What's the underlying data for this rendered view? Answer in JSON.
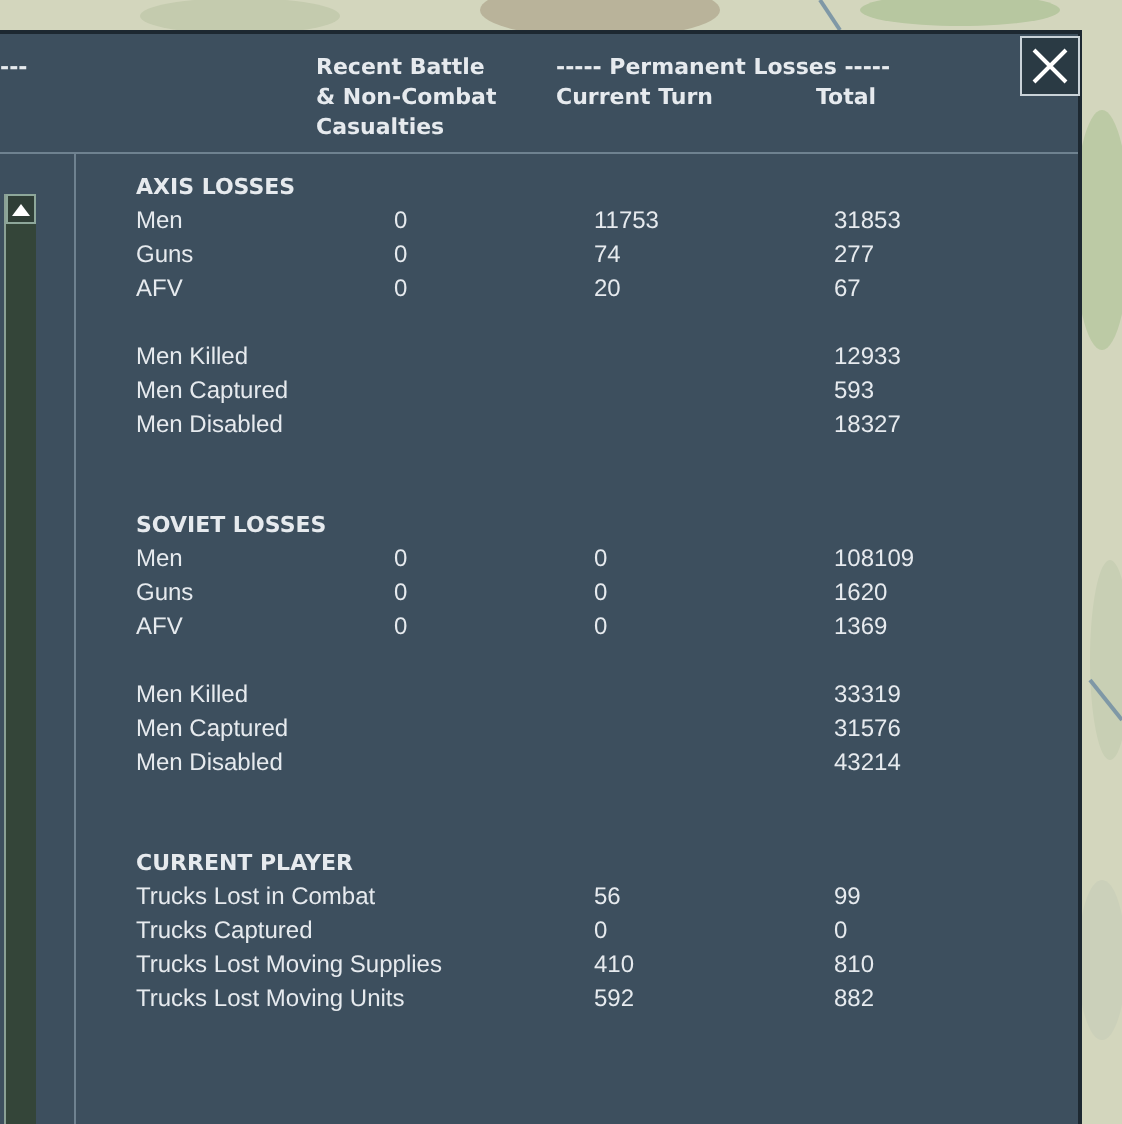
{
  "header": {
    "left_fragment": "---",
    "recent_battle_lines": [
      "Recent Battle",
      "& Non-Combat",
      "Casualties"
    ],
    "permanent_heading": "----- Permanent Losses -----",
    "current_turn_heading": "Current Turn",
    "total_heading": "Total"
  },
  "sections": [
    {
      "title": "AXIS LOSSES",
      "groups": [
        [
          {
            "label": "Men",
            "battle": "0",
            "current": "11753",
            "total": "31853"
          },
          {
            "label": "Guns",
            "battle": "0",
            "current": "74",
            "total": "277"
          },
          {
            "label": "AFV",
            "battle": "0",
            "current": "20",
            "total": "67"
          }
        ],
        [
          {
            "label": "Men Killed",
            "total": "12933"
          },
          {
            "label": "Men Captured",
            "total": "593"
          },
          {
            "label": "Men Disabled",
            "total": "18327"
          }
        ]
      ]
    },
    {
      "title": "SOVIET LOSSES",
      "groups": [
        [
          {
            "label": "Men",
            "battle": "0",
            "current": "0",
            "total": "108109"
          },
          {
            "label": "Guns",
            "battle": "0",
            "current": "0",
            "total": "1620"
          },
          {
            "label": "AFV",
            "battle": "0",
            "current": "0",
            "total": "1369"
          }
        ],
        [
          {
            "label": "Men Killed",
            "total": "33319"
          },
          {
            "label": "Men Captured",
            "total": "31576"
          },
          {
            "label": "Men Disabled",
            "total": "43214"
          }
        ]
      ]
    },
    {
      "title": "CURRENT PLAYER",
      "groups": [
        [
          {
            "label": "Trucks Lost in Combat",
            "current": "56",
            "total": "99"
          },
          {
            "label": "Trucks Captured",
            "current": "0",
            "total": "0"
          },
          {
            "label": "Trucks Lost Moving Supplies",
            "current": "410",
            "total": "810"
          },
          {
            "label": "Trucks Lost Moving Units",
            "current": "592",
            "total": "882"
          }
        ]
      ]
    }
  ]
}
